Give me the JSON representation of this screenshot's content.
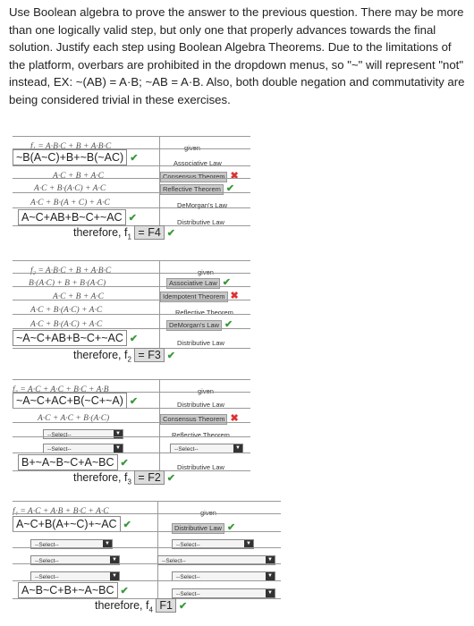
{
  "intro": "Use Boolean algebra to prove the answer to the previous question. There may be more than one logically valid step, but only one that properly advances towards the final solution. Justify each step using Boolean Algebra Theorems. Due to the limitations of the platform, overbars are prohibited in the dropdown menus, so \"~\" will represent \"not\" instead, EX: ~(AB) = A·B; ~AB = A·B. Also, both double negation and commutativity are being considered trivial in these exercises.",
  "select_placeholder": "--Select--",
  "blocks": [
    {
      "steps": [
        "f₁ = A·B·C + B + A·B·C",
        "~B(A~C)+B+~B(~AC)",
        "A·C + B + A·C",
        "A·C + B·(A·C) + A·C",
        "A·C + B·(A + C) + A·C",
        "A~C+AB+B~C+~AC"
      ],
      "laws": [
        "given",
        "Associative Law",
        "Consensus Theorem",
        "Reflective Theorem",
        "DeMorgan's Law",
        "Distributive Law"
      ],
      "therefore": "therefore, f",
      "sub": "1",
      "eq": "=",
      "answer": "F4"
    },
    {
      "steps": [
        "f₂ = A·B·C + B + A·B·C",
        "B·(A·C) + B + B·(A·C)",
        "A·C + B + A·C",
        "A·C + B·(A·C) + A·C",
        "A·C + B·(A·C) + A·C",
        "~A~C+AB+B~C+~AC"
      ],
      "laws": [
        "given",
        "Associative Law",
        "Idempotent Theorem",
        "Reflective Theorem",
        "DeMorgan's Law",
        "Distributive Law"
      ],
      "therefore": "therefore, f",
      "sub": "2",
      "eq": "=",
      "answer": "F3"
    },
    {
      "steps": [
        "f₃ = A·C + A·C + B·C + A·B",
        "~A~C+AC+B(~C+~A)",
        "A·C + A·C + B·(A·C)",
        "B+~A~B~C+A~BC"
      ],
      "laws": [
        "given",
        "Distributive Law",
        "Consensus Theorem",
        "Reflective Theorem",
        "Distributive Law"
      ],
      "therefore": "therefore, f",
      "sub": "3",
      "eq": "=",
      "answer": "F2"
    },
    {
      "steps": [
        "f₄ = A·C + A·B + B·C + A·C",
        "A~C+B(A+~C)+~AC",
        "A~B~C+B+~A~BC"
      ],
      "laws": [
        "given",
        "Distributive Law"
      ],
      "therefore": "therefore, f",
      "sub": "4",
      "answer": "F1"
    }
  ]
}
